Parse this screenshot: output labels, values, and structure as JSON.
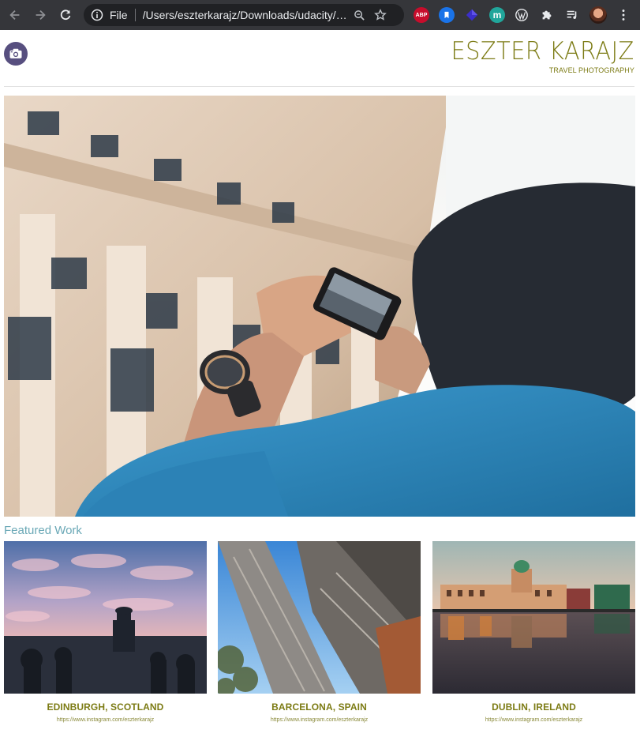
{
  "browser": {
    "scheme": "File",
    "url": "/Users/eszterkarajz/Downloads/udacity/index.html",
    "extensions": {
      "abp_label": "ABP",
      "m_label": "m"
    }
  },
  "header": {
    "brand_name": "ESZTER KARAJZ",
    "brand_tagline": "TRAVEL PHOTOGRAPHY"
  },
  "featured": {
    "title": "Featured Work",
    "items": [
      {
        "caption": "EDINBURGH, SCOTLAND",
        "link": "https://www.instagram.com/eszterkarajz"
      },
      {
        "caption": "BARCELONA, SPAIN",
        "link": "https://www.instagram.com/eszterkarajz"
      },
      {
        "caption": "DUBLIN, IRELAND",
        "link": "https://www.instagram.com/eszterkarajz"
      }
    ]
  },
  "colors": {
    "chrome_bg": "#35363a",
    "omnibox_bg": "#202124",
    "brand_olive": "#7c7b14",
    "featured_blue": "#6aa8b6",
    "logo_purple": "#574f7f"
  }
}
